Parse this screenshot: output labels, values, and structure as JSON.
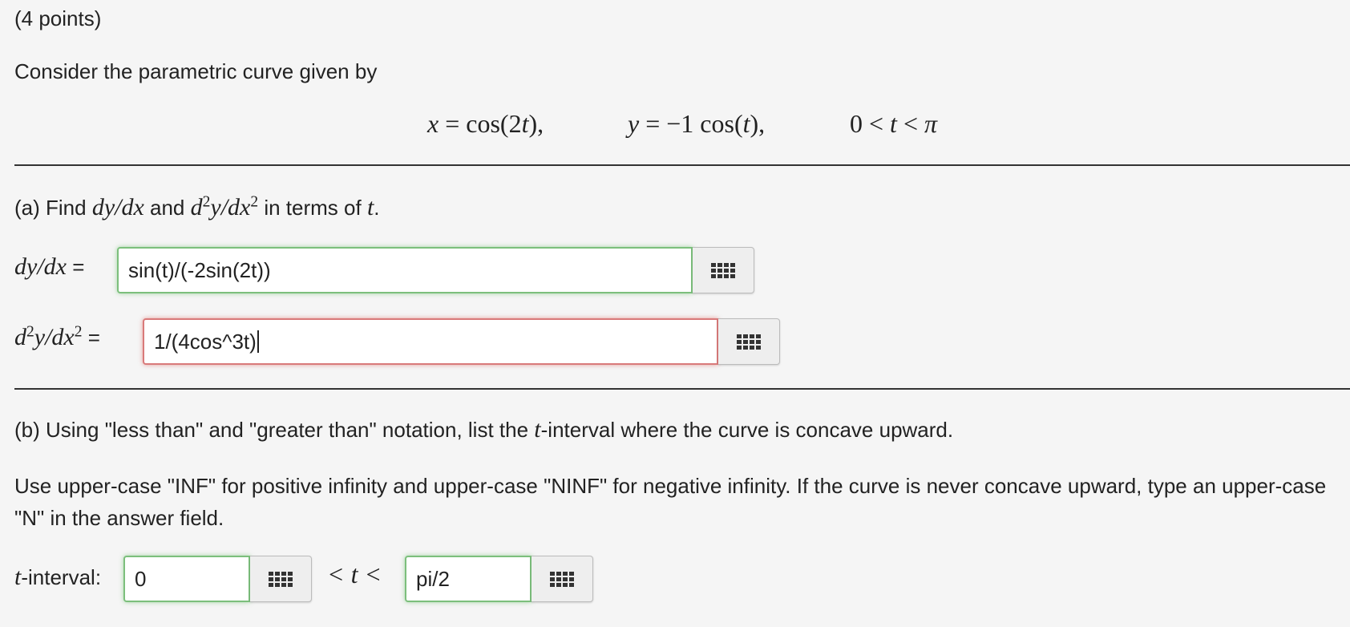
{
  "points": "(4 points)",
  "intro": "Consider the parametric curve given by",
  "equation": {
    "x_lhs": "x",
    "eq": "=",
    "x_rhs_fn": "cos",
    "x_rhs_arg_a": "(2",
    "x_rhs_arg_t": "t",
    "x_rhs_arg_b": "),",
    "y_lhs": "y",
    "y_rhs_coef": "−1",
    "y_rhs_fn": "cos",
    "y_rhs_arg_a": "(",
    "y_rhs_arg_t": "t",
    "y_rhs_arg_b": "),",
    "range_lo": "0 <",
    "range_t": "t",
    "range_lt": "<",
    "range_pi": "π"
  },
  "part_a": {
    "prefix": "(a) Find",
    "and": "and",
    "suffix": "in terms of",
    "t": "t",
    "period": ".",
    "dydx_label": "dy/dx",
    "d2_label": "d",
    "d2_sup": "2",
    "d2_mid": "y/dx",
    "d2_sup2": "2",
    "equals": "=",
    "dydx_value": "sin(t)/(-2sin(2t))",
    "d2ydx2_value": "1/(4cos^3t)"
  },
  "part_b": {
    "prefix": "(b) Using \"less than\" and \"greater than\" notation, list the",
    "t": "t",
    "suffix": "-interval where the curve is concave upward.",
    "instructions": "Use upper-case \"INF\" for positive infinity and upper-case \"NINF\" for negative infinity. If the curve is never concave upward, type an upper-case \"N\" in the answer field.",
    "interval_label_suffix": "-interval:",
    "lower_value": "0",
    "between": "< t <",
    "upper_value": "pi/2"
  },
  "icons": {
    "keypad": "keypad-grid-icon"
  },
  "colors": {
    "correct_border": "#7cbf7c",
    "incorrect_border": "#d97a7a",
    "background": "#f5f5f5"
  }
}
